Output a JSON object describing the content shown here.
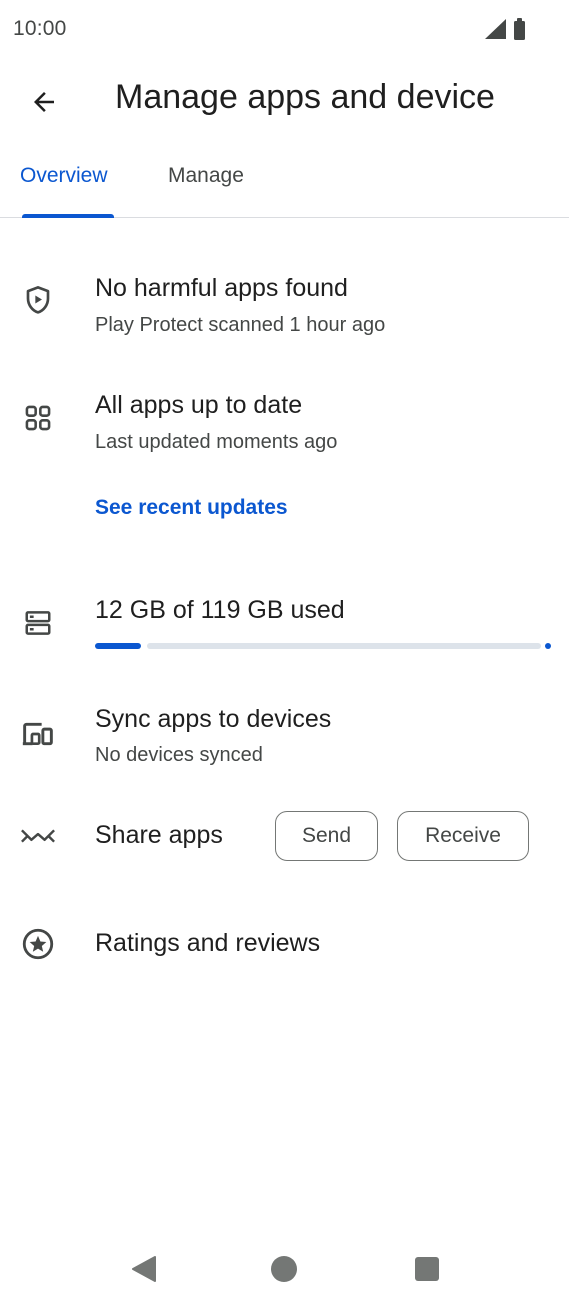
{
  "status_bar": {
    "time": "10:00",
    "icons": [
      "signal-icon",
      "battery-icon"
    ]
  },
  "header": {
    "back_icon": "arrow-back-icon",
    "title": "Manage apps and device"
  },
  "tabs": [
    {
      "label": "Overview",
      "selected": true
    },
    {
      "label": "Manage",
      "selected": false
    }
  ],
  "overview": {
    "play_protect": {
      "icon": "shield-play-icon",
      "title": "No harmful apps found",
      "subtitle": "Play Protect scanned 1 hour ago"
    },
    "updates": {
      "icon": "apps-grid-icon",
      "title": "All apps up to date",
      "subtitle": "Last updated moments ago",
      "link": "See recent updates"
    },
    "storage": {
      "icon": "storage-icon",
      "title": "12 GB of 119 GB used",
      "used_gb": 12,
      "total_gb": 119
    },
    "sync": {
      "icon": "devices-icon",
      "title": "Sync apps to devices",
      "subtitle": "No devices synced"
    },
    "share": {
      "icon": "share-apps-icon",
      "title": "Share apps",
      "send_label": "Send",
      "receive_label": "Receive"
    },
    "ratings": {
      "icon": "star-circle-icon",
      "title": "Ratings and reviews"
    }
  },
  "nav_bar": {
    "buttons": [
      "back-triangle-icon",
      "home-circle-icon",
      "recents-square-icon"
    ]
  },
  "colors": {
    "accent": "#0b57d0",
    "text_primary": "#1f1f1f",
    "text_secondary": "#444746",
    "divider": "#dadce0",
    "track": "#dde3ea"
  }
}
